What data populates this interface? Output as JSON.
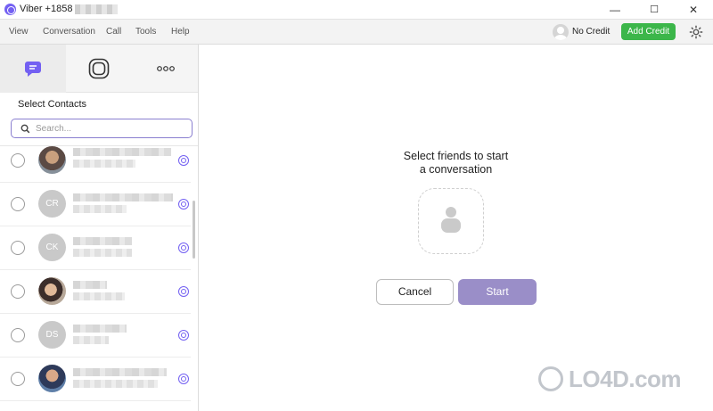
{
  "window": {
    "title": "Viber +1858",
    "controls": {
      "minimize": "—",
      "maximize": "☐",
      "close": "✕"
    }
  },
  "menubar": {
    "items": [
      "View",
      "Conversation",
      "Call",
      "Tools",
      "Help"
    ],
    "credit_status": "No Credit",
    "add_credit_label": "Add Credit"
  },
  "sidebar": {
    "tabs": [
      {
        "name": "chats",
        "icon": "chat-bubble-icon",
        "active": true
      },
      {
        "name": "public-accounts",
        "icon": "public-chats-icon",
        "active": false
      },
      {
        "name": "more",
        "icon": "more-dots-icon",
        "active": false
      }
    ],
    "select_label": "Select Contacts",
    "search": {
      "placeholder": "Search...",
      "value": ""
    },
    "contacts": [
      {
        "avatar": "photo",
        "initials": ""
      },
      {
        "avatar": "initials",
        "initials": "CR"
      },
      {
        "avatar": "initials",
        "initials": "CK"
      },
      {
        "avatar": "photo",
        "initials": ""
      },
      {
        "avatar": "initials",
        "initials": "DS"
      },
      {
        "avatar": "photo",
        "initials": ""
      }
    ]
  },
  "main": {
    "prompt_line1": "Select friends to start",
    "prompt_line2": "a conversation",
    "cancel_label": "Cancel",
    "start_label": "Start"
  },
  "watermark": "LO4D.com",
  "colors": {
    "viber_purple": "#7360f2",
    "add_credit_green": "#3cb64a",
    "start_button": "#9a8ec8"
  }
}
